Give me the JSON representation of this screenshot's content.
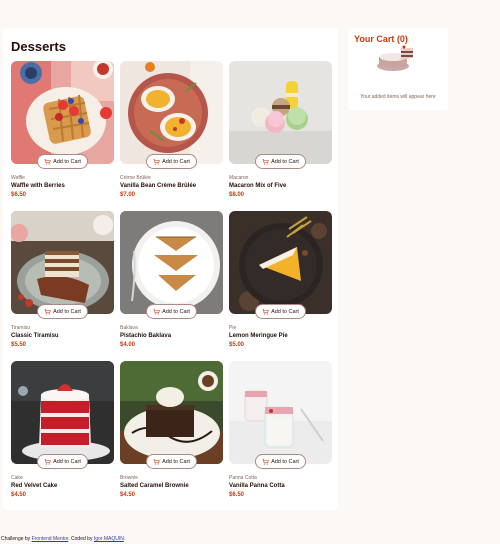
{
  "page": {
    "title": "Desserts"
  },
  "products": [
    {
      "category": "Waffle",
      "name": "Waffle with Berries",
      "price": "$6.50",
      "button": "Add to Cart",
      "image": "waffle"
    },
    {
      "category": "Crème Brûlée",
      "name": "Vanilla Bean Crème Brûlée",
      "price": "$7.00",
      "button": "Add to Cart",
      "image": "creme-brulee"
    },
    {
      "category": "Macaron",
      "name": "Macaron Mix of Five",
      "price": "$8.00",
      "button": "Add to Cart",
      "image": "macaron"
    },
    {
      "category": "Tiramisu",
      "name": "Classic Tiramisu",
      "price": "$5.50",
      "button": "Add to Cart",
      "image": "tiramisu"
    },
    {
      "category": "Baklava",
      "name": "Pistachio Baklava",
      "price": "$4.00",
      "button": "Add to Cart",
      "image": "baklava"
    },
    {
      "category": "Pie",
      "name": "Lemon Meringue Pie",
      "price": "$5.00",
      "button": "Add to Cart",
      "image": "pie"
    },
    {
      "category": "Cake",
      "name": "Red Velvet Cake",
      "price": "$4.50",
      "button": "Add to Cart",
      "image": "cake"
    },
    {
      "category": "Brownie",
      "name": "Salted Caramel Brownie",
      "price": "$4.50",
      "button": "Add to Cart",
      "image": "brownie"
    },
    {
      "category": "Panna Cotta",
      "name": "Vanilla Panna Cotta",
      "price": "$6.50",
      "button": "Add to Cart",
      "image": "panna-cotta"
    }
  ],
  "cart": {
    "title": "Your Cart (0)",
    "empty_text": "Your added items will appear here"
  },
  "attribution": {
    "prefix": "Challenge by ",
    "link1": "Frontend Mentor",
    "middle": ". Coded by ",
    "link2": "Igor MAQUIN",
    "suffix": "."
  },
  "colors": {
    "accent": "#c73a0f",
    "text": "#260f08",
    "muted": "#87635a",
    "background": "#fcf8f5"
  }
}
